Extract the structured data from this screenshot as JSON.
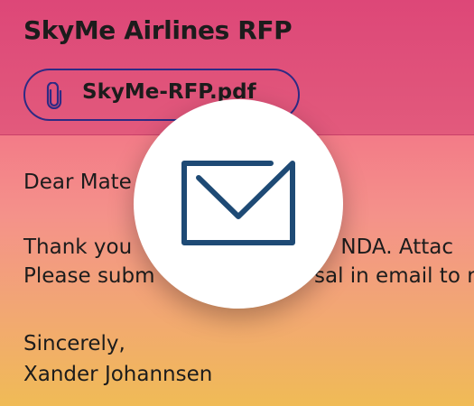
{
  "email": {
    "subject": "SkyMe Airlines RFP",
    "attachment": {
      "filename": "SkyMe-RFP.pdf",
      "icon": "paperclip-icon"
    },
    "greeting": "Dear Mate",
    "body_line_1": "Thank you",
    "body_line_1_right": "our NDA. Attac",
    "body_line_2": "Please subm",
    "body_line_2_right": "sal in email to r",
    "closing": "Sincerely,",
    "signature": "Xander Johannsen"
  },
  "overlay": {
    "icon": "envelope-icon"
  },
  "colors": {
    "header": "#dd4778",
    "attachment_border": "#2e2a84",
    "envelope_stroke": "#1e4a75"
  }
}
